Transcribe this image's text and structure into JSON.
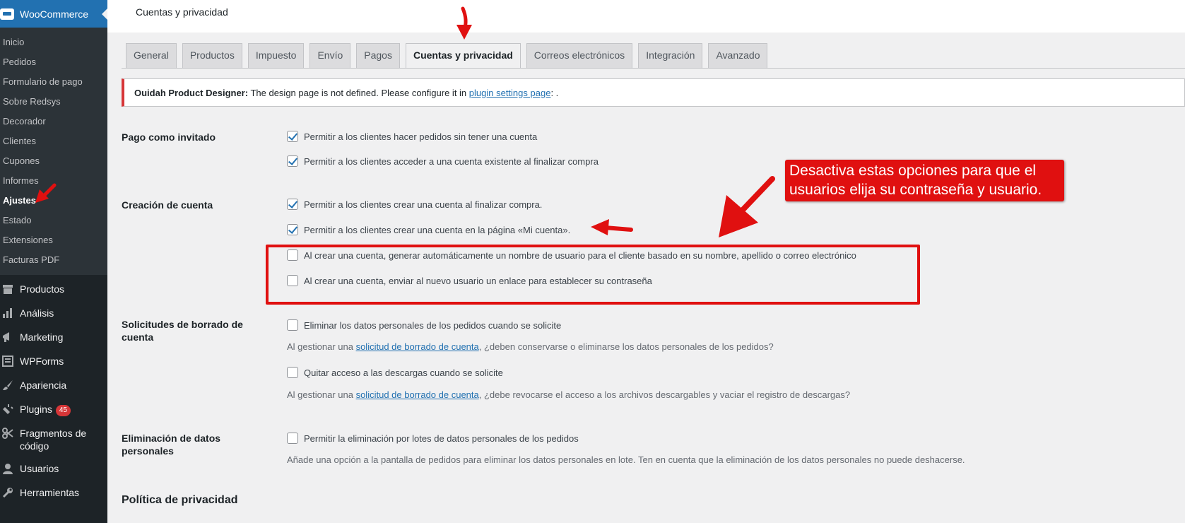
{
  "sidebar": {
    "brand": "WooCommerce",
    "sub_items": [
      {
        "label": "Inicio"
      },
      {
        "label": "Pedidos"
      },
      {
        "label": "Formulario de pago"
      },
      {
        "label": "Sobre Redsys"
      },
      {
        "label": "Decorador"
      },
      {
        "label": "Clientes"
      },
      {
        "label": "Cupones"
      },
      {
        "label": "Informes"
      },
      {
        "label": "Ajustes"
      },
      {
        "label": "Estado"
      },
      {
        "label": "Extensiones"
      },
      {
        "label": "Facturas PDF"
      }
    ],
    "menu": [
      {
        "label": "Productos",
        "icon": "archive-icon"
      },
      {
        "label": "Análisis",
        "icon": "bar-chart-icon"
      },
      {
        "label": "Marketing",
        "icon": "megaphone-icon"
      },
      {
        "label": "WPForms",
        "icon": "form-icon"
      },
      {
        "label": "Apariencia",
        "icon": "paintbrush-icon"
      },
      {
        "label": "Plugins",
        "icon": "plug-icon",
        "badge": "45"
      },
      {
        "label": "Fragmentos de código",
        "icon": "scissors-icon"
      },
      {
        "label": "Usuarios",
        "icon": "user-icon"
      },
      {
        "label": "Herramientas",
        "icon": "wrench-icon"
      }
    ]
  },
  "header": {
    "title": "Cuentas y privacidad"
  },
  "tabs": [
    {
      "label": "General"
    },
    {
      "label": "Productos"
    },
    {
      "label": "Impuesto"
    },
    {
      "label": "Envío"
    },
    {
      "label": "Pagos"
    },
    {
      "label": "Cuentas y privacidad",
      "active": true
    },
    {
      "label": "Correos electrónicos"
    },
    {
      "label": "Integración"
    },
    {
      "label": "Avanzado"
    }
  ],
  "notice": {
    "plugin": "Ouidah Product Designer:",
    "text": " The design page is not defined. Please configure it in ",
    "link": "plugin settings page",
    "tail": ": ."
  },
  "settings": {
    "guest": {
      "label": "Pago como invitado",
      "opt1": "Permitir a los clientes hacer pedidos sin tener una cuenta",
      "opt2": "Permitir a los clientes acceder a una cuenta existente al finalizar compra"
    },
    "account": {
      "label": "Creación de cuenta",
      "opt1": "Permitir a los clientes crear una cuenta al finalizar compra.",
      "opt2": "Permitir a los clientes crear una cuenta en la página «Mi cuenta».",
      "opt3": "Al crear una cuenta, generar automáticamente un nombre de usuario para el cliente basado en su nombre, apellido o correo electrónico",
      "opt4": "Al crear una cuenta, enviar al nuevo usuario un enlace para establecer su contraseña"
    },
    "erasure": {
      "label": "Solicitudes de borrado de cuenta",
      "opt1": "Eliminar los datos personales de los pedidos cuando se solicite",
      "desc1_pre": "Al gestionar una ",
      "desc1_link": "solicitud de borrado de cuenta",
      "desc1_post": ", ¿deben conservarse o eliminarse los datos personales de los pedidos?",
      "opt2": "Quitar acceso a las descargas cuando se solicite",
      "desc2_pre": "Al gestionar una ",
      "desc2_link": "solicitud de borrado de cuenta",
      "desc2_post": ", ¿debe revocarse el acceso a los archivos descargables y vaciar el registro de descargas?"
    },
    "removal": {
      "label": "Eliminación de datos personales",
      "opt1": "Permitir la eliminación por lotes de datos personales de los pedidos",
      "desc": "Añade una opción a la pantalla de pedidos para eliminar los datos personales en lote. Ten en cuenta que la eliminación de los datos personales no puede deshacerse."
    },
    "privacy_heading": "Política de privacidad"
  },
  "annotation": {
    "callout": "Desactiva estas opciones para que el usuarios elija su contraseña y usuario.",
    "color": "#e01010"
  }
}
